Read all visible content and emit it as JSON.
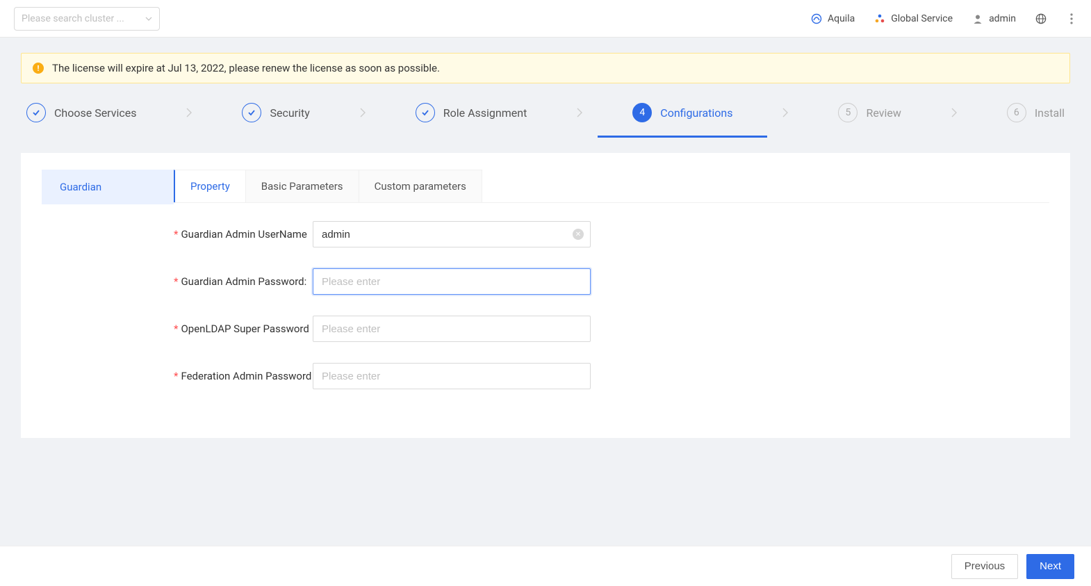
{
  "header": {
    "search_placeholder": "Please search cluster ...",
    "aquila": "Aquila",
    "global_service": "Global Service",
    "user": "admin"
  },
  "warning": {
    "text": "The license will expire at Jul 13, 2022, please renew the license as soon as possible."
  },
  "steps": [
    {
      "label": "Choose Services",
      "state": "done"
    },
    {
      "label": "Security",
      "state": "done"
    },
    {
      "label": "Role Assignment",
      "state": "done"
    },
    {
      "label": "Configurations",
      "state": "active",
      "num": "4"
    },
    {
      "label": "Review",
      "state": "todo",
      "num": "5"
    },
    {
      "label": "Install",
      "state": "todo",
      "num": "6"
    }
  ],
  "sidebar": {
    "items": [
      {
        "label": "Guardian",
        "active": true
      }
    ]
  },
  "tabs": [
    {
      "label": "Property",
      "active": true
    },
    {
      "label": "Basic Parameters",
      "active": false
    },
    {
      "label": "Custom parameters",
      "active": false
    }
  ],
  "form": {
    "rows": [
      {
        "label": "Guardian Admin UserName",
        "value": "admin",
        "placeholder": "",
        "focused": false,
        "clearable": true
      },
      {
        "label": "Guardian Admin Password:",
        "value": "",
        "placeholder": "Please enter",
        "focused": true,
        "clearable": false
      },
      {
        "label": "OpenLDAP Super Password",
        "value": "",
        "placeholder": "Please enter",
        "focused": false,
        "clearable": false
      },
      {
        "label": "Federation Admin Password",
        "value": "",
        "placeholder": "Please enter",
        "focused": false,
        "clearable": false
      }
    ]
  },
  "footer": {
    "previous": "Previous",
    "next": "Next"
  }
}
